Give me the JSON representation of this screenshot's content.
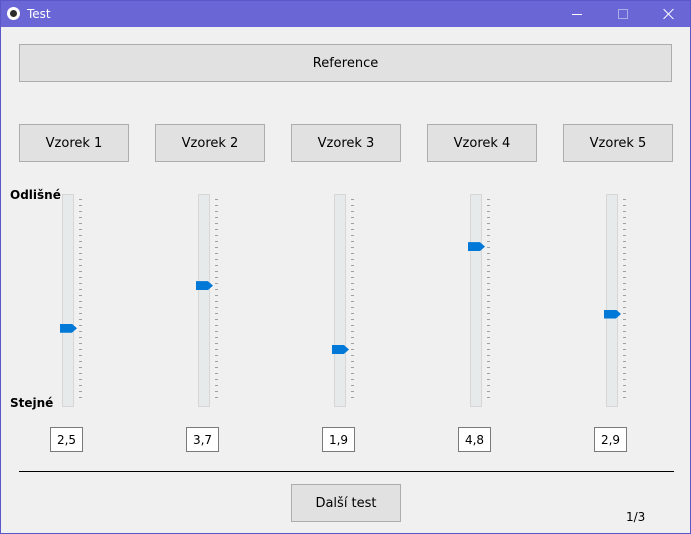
{
  "window": {
    "title": "Test"
  },
  "reference_button": "Reference",
  "axis": {
    "top_label": "Odlišné",
    "bottom_label": "Stejné"
  },
  "scale": {
    "min": 0,
    "max": 6
  },
  "samples": [
    {
      "label": "Vzorek 1",
      "value_text": "2,5",
      "value": 2.5
    },
    {
      "label": "Vzorek 2",
      "value_text": "3,7",
      "value": 3.7
    },
    {
      "label": "Vzorek 3",
      "value_text": "1,9",
      "value": 1.9
    },
    {
      "label": "Vzorek 4",
      "value_text": "4,8",
      "value": 4.8
    },
    {
      "label": "Vzorek 5",
      "value_text": "2,9",
      "value": 2.9
    }
  ],
  "next_button": "Další test",
  "counter": "1/3",
  "colors": {
    "titlebar": "#6a66d6",
    "thumb": "#0078d7",
    "background": "#f0f0f0"
  },
  "icons": {
    "app": "app-icon",
    "minimize": "minimize-icon",
    "maximize": "maximize-icon",
    "close": "close-icon"
  }
}
